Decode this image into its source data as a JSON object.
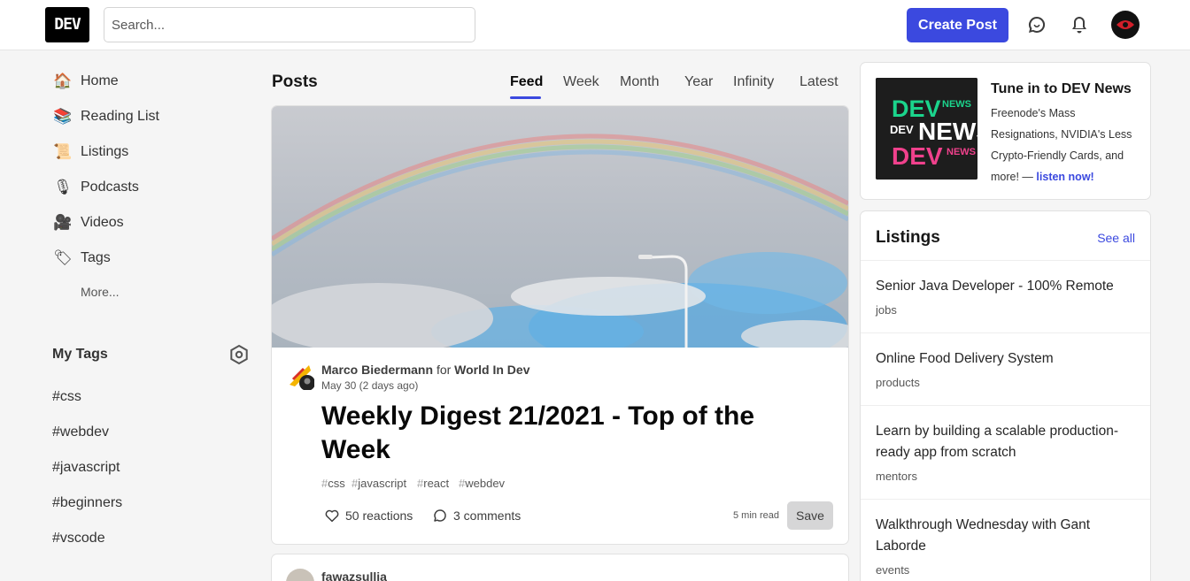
{
  "header": {
    "logo_text": "DEV",
    "search_placeholder": "Search...",
    "create_post_label": "Create Post",
    "icons": [
      "chat-icon",
      "bell-icon",
      "avatar"
    ]
  },
  "sidebar": {
    "items": [
      {
        "label": "Home",
        "icon": "house-icon"
      },
      {
        "label": "Reading List",
        "icon": "reading-list-icon"
      },
      {
        "label": "Listings",
        "icon": "scroll-icon"
      },
      {
        "label": "Podcasts",
        "icon": "microphone-icon"
      },
      {
        "label": "Videos",
        "icon": "camera-icon"
      },
      {
        "label": "Tags",
        "icon": "tag-icon"
      }
    ],
    "more_label": "More...",
    "my_tags_title": "My Tags",
    "tags": [
      "#css",
      "#webdev",
      "#javascript",
      "#beginners",
      "#vscode"
    ]
  },
  "main": {
    "title": "Posts",
    "tabs": [
      "Feed",
      "Week",
      "Month",
      "Year",
      "Infinity",
      "Latest"
    ],
    "active_tab": "Feed",
    "post": {
      "author": "Marco Biedermann",
      "for_text": "for",
      "org": "World In Dev",
      "date": "May 30 (2 days ago)",
      "title": "Weekly Digest 21/2021 - Top of the Week",
      "tags": [
        "css",
        "javascript",
        "react",
        "webdev"
      ],
      "reactions": "50 reactions",
      "comments": "3 comments",
      "read_time": "5 min read",
      "save_label": "Save"
    },
    "next_post": {
      "author": "fawazsullia"
    }
  },
  "right": {
    "news": {
      "image_lines": [
        "DEV",
        "NEWS",
        "DEV",
        "NEWS",
        "DEV",
        "NEWS"
      ],
      "title": "Tune in to DEV News",
      "text": "Freenode's Mass Resignations, NVIDIA's Less Crypto-Friendly Cards, and more! —",
      "link": "listen now!"
    },
    "listings": {
      "title": "Listings",
      "see_all": "See all",
      "items": [
        {
          "title": "Senior Java Developer - 100% Remote",
          "category": "jobs"
        },
        {
          "title": "Online Food Delivery System",
          "category": "products"
        },
        {
          "title": "Learn by building a scalable production-ready app from scratch",
          "category": "mentors"
        },
        {
          "title": "Walkthrough Wednesday with Gant Laborde",
          "category": "events"
        }
      ]
    }
  },
  "colors": {
    "accent": "#3b49df",
    "background": "#f5f5f5",
    "news_green": "#1bd48c",
    "news_pink": "#f0418c"
  }
}
